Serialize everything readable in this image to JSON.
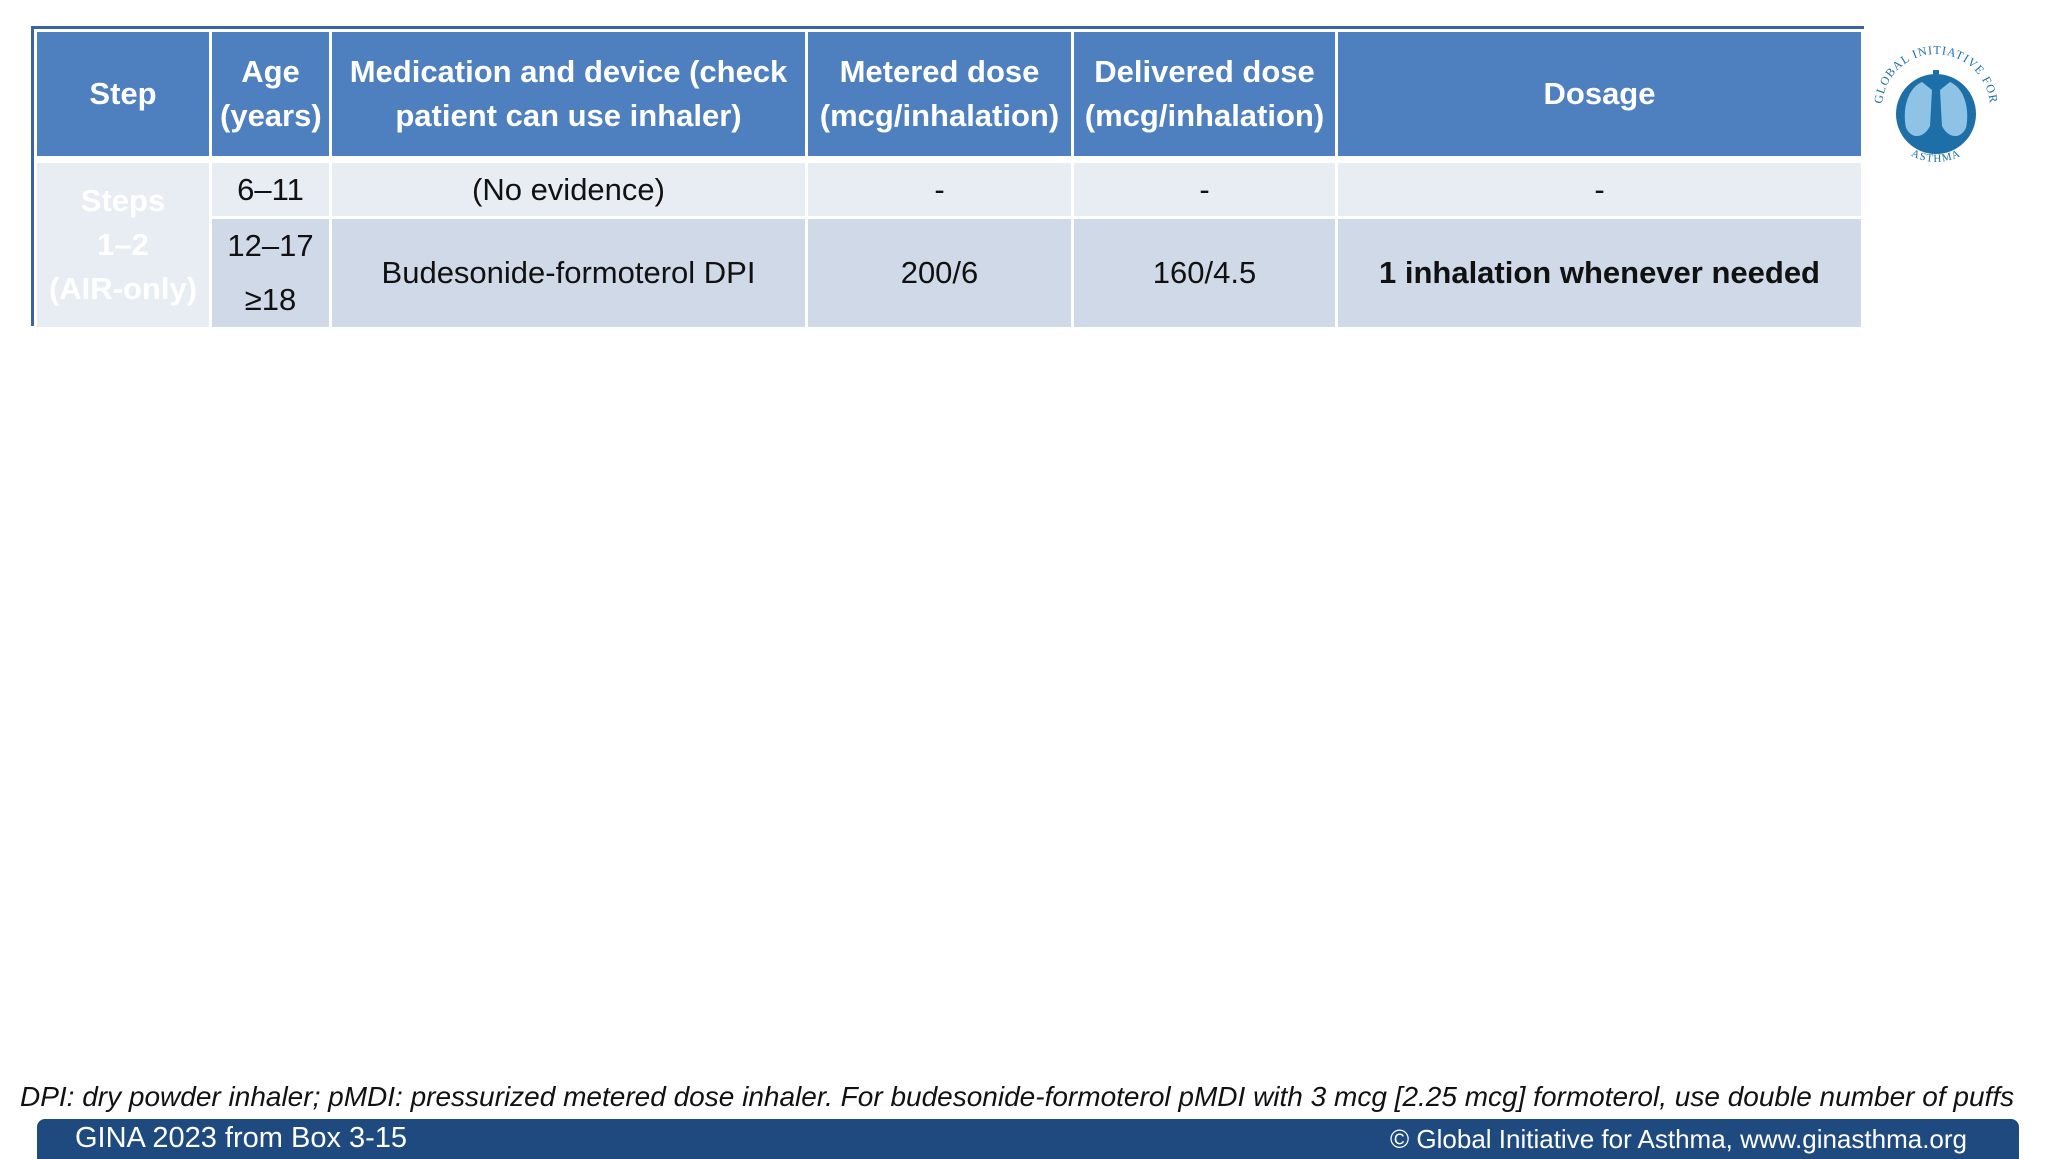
{
  "table": {
    "headers": {
      "step": "Step",
      "age_line1": "Age",
      "age_line2": "(years)",
      "med_line1": "Medication and device (check",
      "med_line2": "patient can use inhaler)",
      "metered_line1": "Metered dose",
      "metered_line2": "(mcg/inhalation)",
      "delivered_line1": "Delivered dose",
      "delivered_line2": "(mcg/inhalation)",
      "dosage": "Dosage"
    },
    "step_label": [
      "Steps",
      "1–2",
      "(AIR-only)"
    ],
    "rows": [
      {
        "age": "6–11",
        "medication": "(No evidence)",
        "metered": "-",
        "delivered": "-",
        "dosage": "-"
      },
      {
        "age_a": "12–17",
        "age_b": "≥18",
        "medication": "Budesonide-formoterol DPI",
        "metered": "200/6",
        "delivered": "160/4.5",
        "dosage": "1 inhalation whenever needed"
      }
    ]
  },
  "logo": {
    "arc_text_top": "GLOBAL INITIATIVE FOR",
    "arc_text_bottom": "ASTHMA",
    "colors": {
      "blue": "#1e6fa8",
      "light": "#8fc3e6"
    }
  },
  "footnote": "DPI: dry powder inhaler; pMDI: pressurized metered dose inhaler. For budesonide-formoterol pMDI with 3 mcg [2.25 mcg] formoterol, use double number of puffs",
  "footer": {
    "left": "GINA 2023 from Box 3-15",
    "right": "© Global Initiative for Asthma, www.ginasthma.org"
  },
  "colors": {
    "header_bg": "#4e7fbf",
    "row_light": "#e8ecf3",
    "row_mid": "#cfd9e8",
    "footer_bg": "#1f4a80"
  }
}
